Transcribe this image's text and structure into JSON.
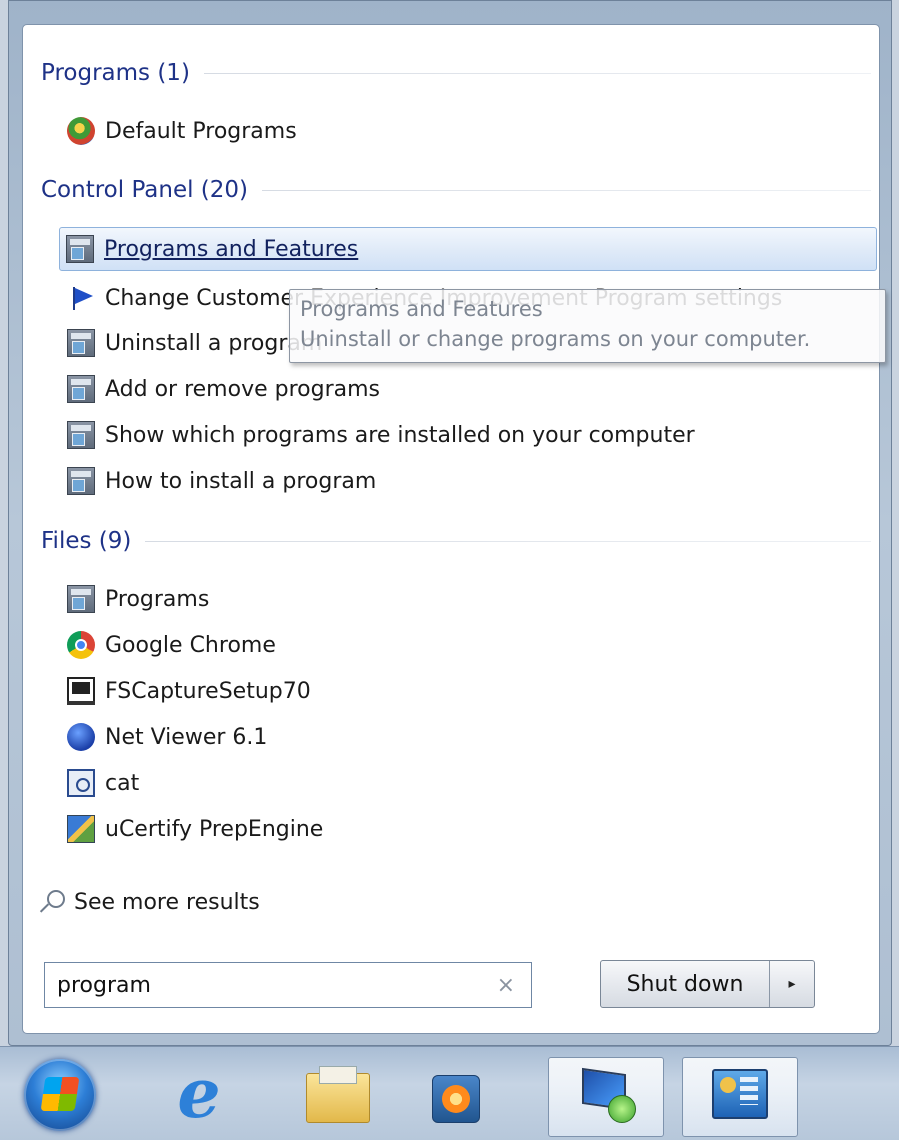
{
  "groups": {
    "programs": {
      "title": "Programs (1)",
      "items": [
        {
          "label": "Default Programs",
          "icon": "default-programs-icon"
        }
      ]
    },
    "control_panel": {
      "title": "Control Panel (20)",
      "items": [
        {
          "label": "Programs and Features",
          "icon": "control-panel-icon",
          "highlighted": true
        },
        {
          "label": "Change Customer Experience Improvement Program settings",
          "icon": "flag-icon"
        },
        {
          "label": "Uninstall a program",
          "icon": "control-panel-icon"
        },
        {
          "label": "Add or remove programs",
          "icon": "control-panel-icon"
        },
        {
          "label": "Show which programs are installed on your computer",
          "icon": "control-panel-icon"
        },
        {
          "label": "How to install a program",
          "icon": "control-panel-icon"
        }
      ]
    },
    "files": {
      "title": "Files (9)",
      "items": [
        {
          "label": "Programs",
          "icon": "control-panel-icon"
        },
        {
          "label": "Google Chrome",
          "icon": "chrome-icon"
        },
        {
          "label": "FSCaptureSetup70",
          "icon": "installer-icon"
        },
        {
          "label": "Net Viewer 6.1",
          "icon": "net-viewer-icon"
        },
        {
          "label": "cat",
          "icon": "cat-file-icon"
        },
        {
          "label": "uCertify PrepEngine",
          "icon": "ucertify-icon"
        }
      ]
    }
  },
  "tooltip": {
    "title": "Programs and Features",
    "description": "Uninstall or change programs on your computer."
  },
  "see_more": "See more results",
  "search": {
    "value": "program",
    "clear_glyph": "×"
  },
  "shutdown": {
    "label": "Shut down",
    "arrow_glyph": "▸"
  },
  "taskbar": {
    "items": [
      "start-button",
      "internet-explorer-icon",
      "file-explorer-icon",
      "media-player-icon",
      "remote-desktop-icon",
      "control-panel-icon"
    ]
  },
  "colors": {
    "group_title": "#1e3287",
    "highlight_border": "#8eb2dc",
    "pane_background": "#ffffff"
  }
}
